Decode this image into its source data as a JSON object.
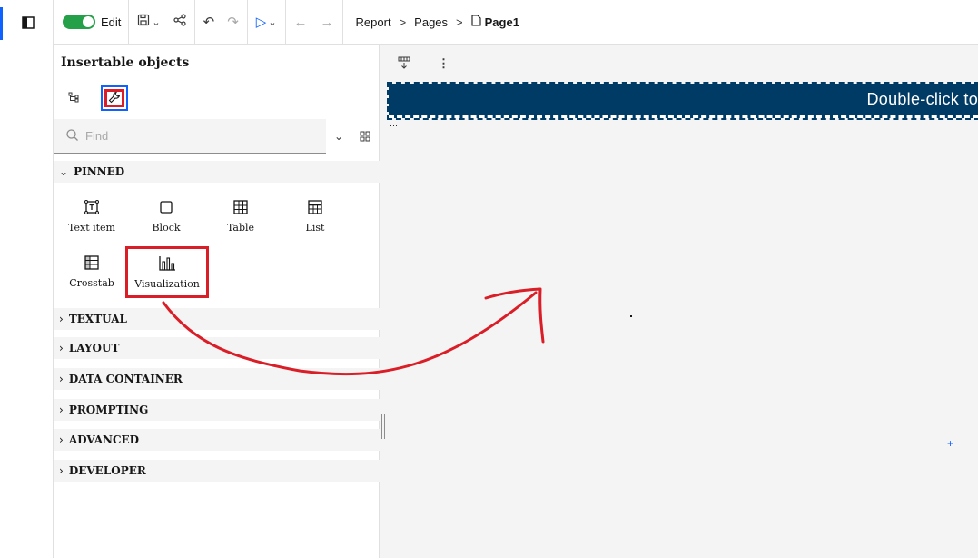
{
  "toolbar": {
    "edit_label": "Edit",
    "breadcrumb": [
      "Report",
      "Pages",
      "Page1"
    ],
    "separator": ">"
  },
  "panel": {
    "title": "Insertable objects",
    "search_placeholder": "Find",
    "sections": {
      "pinned": "PINNED",
      "textual": "TEXTUAL",
      "layout": "LAYOUT",
      "data_container": "DATA CONTAINER",
      "prompting": "PROMPTING",
      "advanced": "ADVANCED",
      "developer": "DEVELOPER"
    },
    "pinned_items": [
      "Text item",
      "Block",
      "Table",
      "List",
      "Crosstab",
      "Visualization"
    ]
  },
  "canvas": {
    "header_text": "Double-click to"
  },
  "colors": {
    "accent": "#0f62fe",
    "toggle_on": "#24a148",
    "annotation_red": "#da1e28",
    "header_band": "#003b66"
  },
  "icons": {
    "panel_toggle": "sidebar-toggle-icon",
    "save": "save-icon",
    "share": "share-icon",
    "undo": "undo-icon",
    "redo": "redo-icon",
    "run": "play-icon",
    "back": "arrow-left-icon",
    "forward": "arrow-right-icon",
    "page": "page-icon"
  }
}
